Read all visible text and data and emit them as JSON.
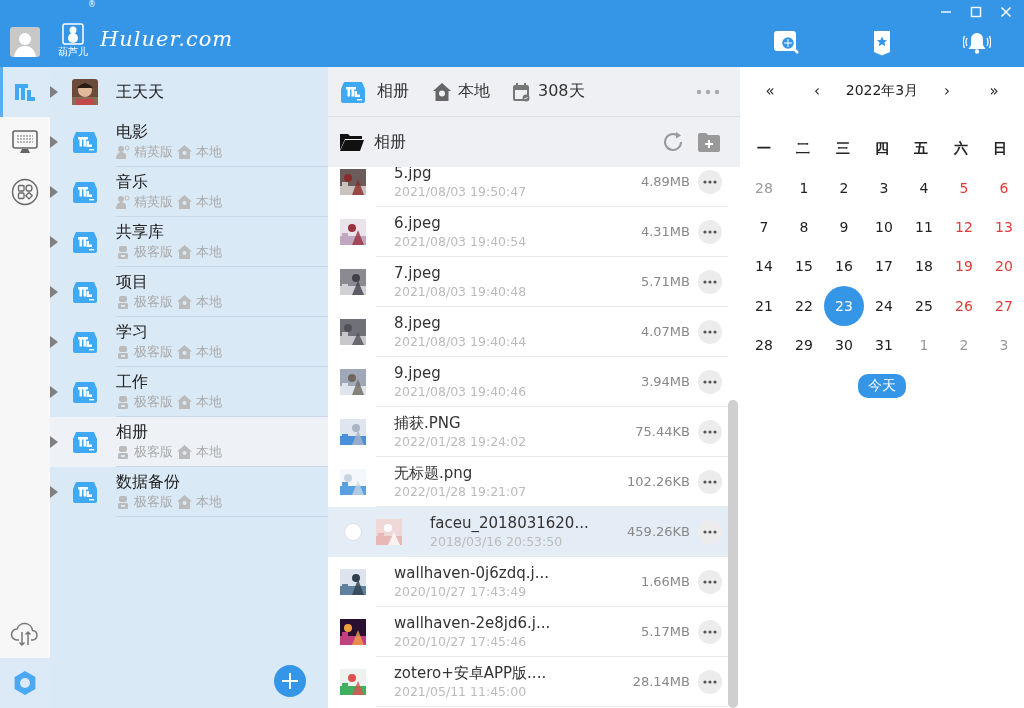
{
  "header": {
    "logo_sub": "葫芦儿",
    "logo_mark": "®",
    "logo_text": "Huluer.com"
  },
  "rail": {
    "items": [
      {
        "kind": "library",
        "selected": true
      },
      {
        "kind": "terminal",
        "selected": false
      },
      {
        "kind": "apps",
        "selected": false
      }
    ],
    "bottom": [
      {
        "kind": "sync"
      },
      {
        "kind": "settings"
      }
    ]
  },
  "tree": {
    "items": [
      {
        "kind": "user",
        "name": "王天天",
        "selected": false
      },
      {
        "kind": "library",
        "name": "电影",
        "edition": {
          "kind": "share",
          "label": "精英版"
        },
        "location": "本地",
        "selected": false
      },
      {
        "kind": "library",
        "name": "音乐",
        "edition": {
          "kind": "share",
          "label": "精英版"
        },
        "location": "本地",
        "selected": false
      },
      {
        "kind": "library",
        "name": "共享库",
        "edition": {
          "kind": "robot",
          "label": "极客版"
        },
        "location": "本地",
        "selected": false
      },
      {
        "kind": "library",
        "name": "项目",
        "edition": {
          "kind": "robot",
          "label": "极客版"
        },
        "location": "本地",
        "selected": false
      },
      {
        "kind": "library",
        "name": "学习",
        "edition": {
          "kind": "robot",
          "label": "极客版"
        },
        "location": "本地",
        "selected": false
      },
      {
        "kind": "library",
        "name": "工作",
        "edition": {
          "kind": "robot",
          "label": "极客版"
        },
        "location": "本地",
        "selected": false
      },
      {
        "kind": "library",
        "name": "相册",
        "edition": {
          "kind": "robot",
          "label": "极客版"
        },
        "location": "本地",
        "selected": true
      },
      {
        "kind": "library",
        "name": "数据备份",
        "edition": {
          "kind": "robot",
          "label": "极客版"
        },
        "location": "本地",
        "selected": false
      }
    ]
  },
  "toolbar": {
    "library": "相册",
    "location": "本地",
    "days": "308天"
  },
  "folder": {
    "name": "相册"
  },
  "files": [
    {
      "name": "5.jpg",
      "date": "2021/08/03 19:50:47",
      "size": "4.89MB",
      "selected": false
    },
    {
      "name": "6.jpeg",
      "date": "2021/08/03 19:40:54",
      "size": "4.31MB",
      "selected": false
    },
    {
      "name": "7.jpeg",
      "date": "2021/08/03 19:40:48",
      "size": "5.71MB",
      "selected": false
    },
    {
      "name": "8.jpeg",
      "date": "2021/08/03 19:40:44",
      "size": "4.07MB",
      "selected": false
    },
    {
      "name": "9.jpeg",
      "date": "2021/08/03 19:40:46",
      "size": "3.94MB",
      "selected": false
    },
    {
      "name": "捕获.PNG",
      "date": "2022/01/28 19:24:02",
      "size": "75.44KB",
      "selected": false
    },
    {
      "name": "无标题.png",
      "date": "2022/01/28 19:21:07",
      "size": "102.26KB",
      "selected": false
    },
    {
      "name": "faceu_2018031620...",
      "date": "2018/03/16 20:53:50",
      "size": "459.26KB",
      "selected": true
    },
    {
      "name": "wallhaven-0j6zdq.j...",
      "date": "2020/10/27 17:43:49",
      "size": "1.66MB",
      "selected": false
    },
    {
      "name": "wallhaven-2e8jd6.j...",
      "date": "2020/10/27 17:45:46",
      "size": "5.17MB",
      "selected": false
    },
    {
      "name": "zotero+安卓APP版....",
      "date": "2021/05/11 11:45:00",
      "size": "28.14MB",
      "selected": false
    }
  ],
  "calendar": {
    "prev_year": "«",
    "prev_month": "‹",
    "title": "2022年3月",
    "next_month": "›",
    "next_year": "»",
    "weekdays": [
      "一",
      "二",
      "三",
      "四",
      "五",
      "六",
      "日"
    ],
    "days": [
      {
        "label": "28",
        "kind": "outside",
        "selected": false
      },
      {
        "label": "1",
        "kind": "weekday",
        "selected": false
      },
      {
        "label": "2",
        "kind": "weekday",
        "selected": false
      },
      {
        "label": "3",
        "kind": "weekday",
        "selected": false
      },
      {
        "label": "4",
        "kind": "weekday",
        "selected": false
      },
      {
        "label": "5",
        "kind": "weekend",
        "selected": false
      },
      {
        "label": "6",
        "kind": "weekend",
        "selected": false
      },
      {
        "label": "7",
        "kind": "weekday",
        "selected": false
      },
      {
        "label": "8",
        "kind": "weekday",
        "selected": false
      },
      {
        "label": "9",
        "kind": "weekday",
        "selected": false
      },
      {
        "label": "10",
        "kind": "weekday",
        "selected": false
      },
      {
        "label": "11",
        "kind": "weekday",
        "selected": false
      },
      {
        "label": "12",
        "kind": "weekend",
        "selected": false
      },
      {
        "label": "13",
        "kind": "weekend",
        "selected": false
      },
      {
        "label": "14",
        "kind": "weekday",
        "selected": false
      },
      {
        "label": "15",
        "kind": "weekday",
        "selected": false
      },
      {
        "label": "16",
        "kind": "weekday",
        "selected": false
      },
      {
        "label": "17",
        "kind": "weekday",
        "selected": false
      },
      {
        "label": "18",
        "kind": "weekday",
        "selected": false
      },
      {
        "label": "19",
        "kind": "weekend",
        "selected": false
      },
      {
        "label": "20",
        "kind": "weekend",
        "selected": false
      },
      {
        "label": "21",
        "kind": "weekday",
        "selected": false
      },
      {
        "label": "22",
        "kind": "weekday",
        "selected": false
      },
      {
        "label": "23",
        "kind": "weekday",
        "selected": true
      },
      {
        "label": "24",
        "kind": "weekday",
        "selected": false
      },
      {
        "label": "25",
        "kind": "weekday",
        "selected": false
      },
      {
        "label": "26",
        "kind": "weekend",
        "selected": false
      },
      {
        "label": "27",
        "kind": "weekend",
        "selected": false
      },
      {
        "label": "28",
        "kind": "weekday",
        "selected": false
      },
      {
        "label": "29",
        "kind": "weekday",
        "selected": false
      },
      {
        "label": "30",
        "kind": "weekday",
        "selected": false
      },
      {
        "label": "31",
        "kind": "weekday",
        "selected": false
      },
      {
        "label": "1",
        "kind": "outside",
        "selected": false
      },
      {
        "label": "2",
        "kind": "outside",
        "selected": false
      },
      {
        "label": "3",
        "kind": "outside",
        "selected": false
      }
    ],
    "today_button": "今天"
  }
}
